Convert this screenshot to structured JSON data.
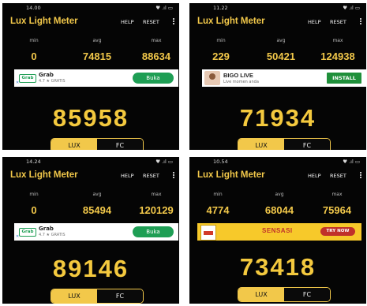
{
  "panels": [
    {
      "status": {
        "time": "14.00",
        "right": "♥ .ıl ▭"
      },
      "app_title": "Lux Light Meter",
      "menu": {
        "help": "HELP",
        "reset": "RESET"
      },
      "stats": {
        "min_label": "min",
        "min_value": "0",
        "avg_label": "avg",
        "avg_value": "74815",
        "max_label": "max",
        "max_value": "88634"
      },
      "ad": {
        "type": "grab",
        "logo": "Grab",
        "name": "Grab",
        "sub": "4.7 ★ GRATIS",
        "button": "Buka"
      },
      "reading": "85958",
      "toggle": {
        "lux": "LUX",
        "fc": "FC"
      }
    },
    {
      "status": {
        "time": "11.22",
        "right": "♥ .ıl ▭"
      },
      "app_title": "Lux Light Meter",
      "menu": {
        "help": "HELP",
        "reset": "RESET"
      },
      "stats": {
        "min_label": "min",
        "min_value": "229",
        "avg_label": "avg",
        "avg_value": "50421",
        "max_label": "max",
        "max_value": "124938"
      },
      "ad": {
        "type": "bigo",
        "name": "BIGO LIVE",
        "sub": "Live momen anda",
        "button": "INSTALL"
      },
      "reading": "71934",
      "toggle": {
        "lux": "LUX",
        "fc": "FC"
      }
    },
    {
      "status": {
        "time": "14.24",
        "right": "♥ .ıl ▭"
      },
      "app_title": "Lux Light Meter",
      "menu": {
        "help": "HELP",
        "reset": "RESET"
      },
      "stats": {
        "min_label": "min",
        "min_value": "0",
        "avg_label": "avg",
        "avg_value": "85494",
        "max_label": "max",
        "max_value": "120129"
      },
      "ad": {
        "type": "grab",
        "logo": "Grab",
        "name": "Grab",
        "sub": "4.7 ★ GRATIS",
        "button": "Buka"
      },
      "reading": "89146",
      "toggle": {
        "lux": "LUX",
        "fc": "FC"
      }
    },
    {
      "status": {
        "time": "10.54",
        "right": "♥ .ıl ▭"
      },
      "app_title": "Lux Light Meter",
      "menu": {
        "help": "HELP",
        "reset": "RESET"
      },
      "stats": {
        "min_label": "min",
        "min_value": "4774",
        "avg_label": "avg",
        "avg_value": "68044",
        "max_label": "max",
        "max_value": "75964"
      },
      "ad": {
        "type": "sensasi",
        "name": "SENSASI",
        "button": "TRY NOW"
      },
      "reading": "73418",
      "toggle": {
        "lux": "LUX",
        "fc": "FC"
      }
    }
  ],
  "colors": {
    "accent": "#f2c84a",
    "background": "#050505",
    "ad_green": "#1e9e54"
  }
}
